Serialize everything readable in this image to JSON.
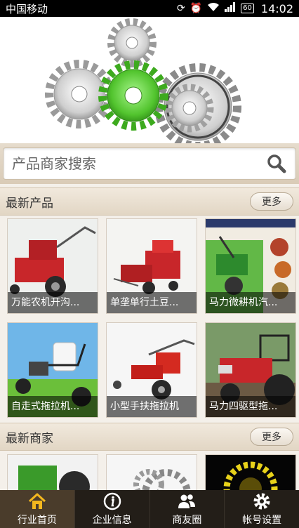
{
  "status_bar": {
    "carrier": "中国移动",
    "battery": "60",
    "time": "14:02"
  },
  "search": {
    "placeholder": "产品商家搜索"
  },
  "latest_products": {
    "title": "最新产品",
    "more_label": "更多",
    "items": [
      {
        "caption": "万能农机开沟..."
      },
      {
        "caption": "单垄单行土豆..."
      },
      {
        "caption": "马力微耕机汽..."
      },
      {
        "caption": "自走式拖拉机..."
      },
      {
        "caption": "小型手扶拖拉机"
      },
      {
        "caption": "马力四驱型拖..."
      }
    ]
  },
  "latest_merchants": {
    "title": "最新商家",
    "more_label": "更多"
  },
  "tabs": [
    {
      "label": "行业首页",
      "icon": "home-icon"
    },
    {
      "label": "企业信息",
      "icon": "info-icon"
    },
    {
      "label": "商友圈",
      "icon": "people-icon"
    },
    {
      "label": "帐号设置",
      "icon": "gear-icon"
    }
  ],
  "colors": {
    "accent_green": "#5cc83a",
    "tab_active": "#4a3c2b",
    "tab_bar": "#231e18"
  }
}
